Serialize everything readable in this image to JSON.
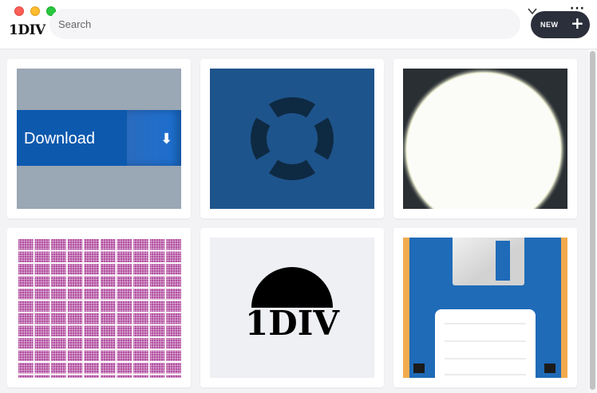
{
  "window": {
    "traffic_lights": [
      "close",
      "minimize",
      "zoom"
    ]
  },
  "header": {
    "logo": "1DIV",
    "search": {
      "placeholder": "Search",
      "value": ""
    },
    "new_button_label": "NEW",
    "new_button_icon": "plus-icon",
    "chevron_icon": "chevron-down-icon",
    "more_icon": "more-horizontal-icon"
  },
  "gallery": {
    "items": [
      {
        "name": "download-button",
        "text": "Download",
        "icon": "arrow-down-icon",
        "colors": {
          "bg": "#9aa7b4",
          "band": "#0d59ae"
        }
      },
      {
        "name": "lifebuoy",
        "colors": {
          "bg": "#1e548c",
          "shape": "#0e2a42"
        }
      },
      {
        "name": "full-moon",
        "colors": {
          "bg": "#2a2f34",
          "moon": "#fbfcf8"
        }
      },
      {
        "name": "grid-pattern",
        "colors": {
          "bg": "#b24fa0",
          "lines": "#ffffff"
        }
      },
      {
        "name": "1div-logo",
        "text": "1DIV",
        "colors": {
          "bg": "#eef0f3",
          "ink": "#000000"
        }
      },
      {
        "name": "floppy-disk",
        "colors": {
          "bg": "#f2ab4e",
          "disk": "#1f6bb8",
          "shutter": "#cfcfcf",
          "label": "#ffffff"
        }
      }
    ]
  }
}
